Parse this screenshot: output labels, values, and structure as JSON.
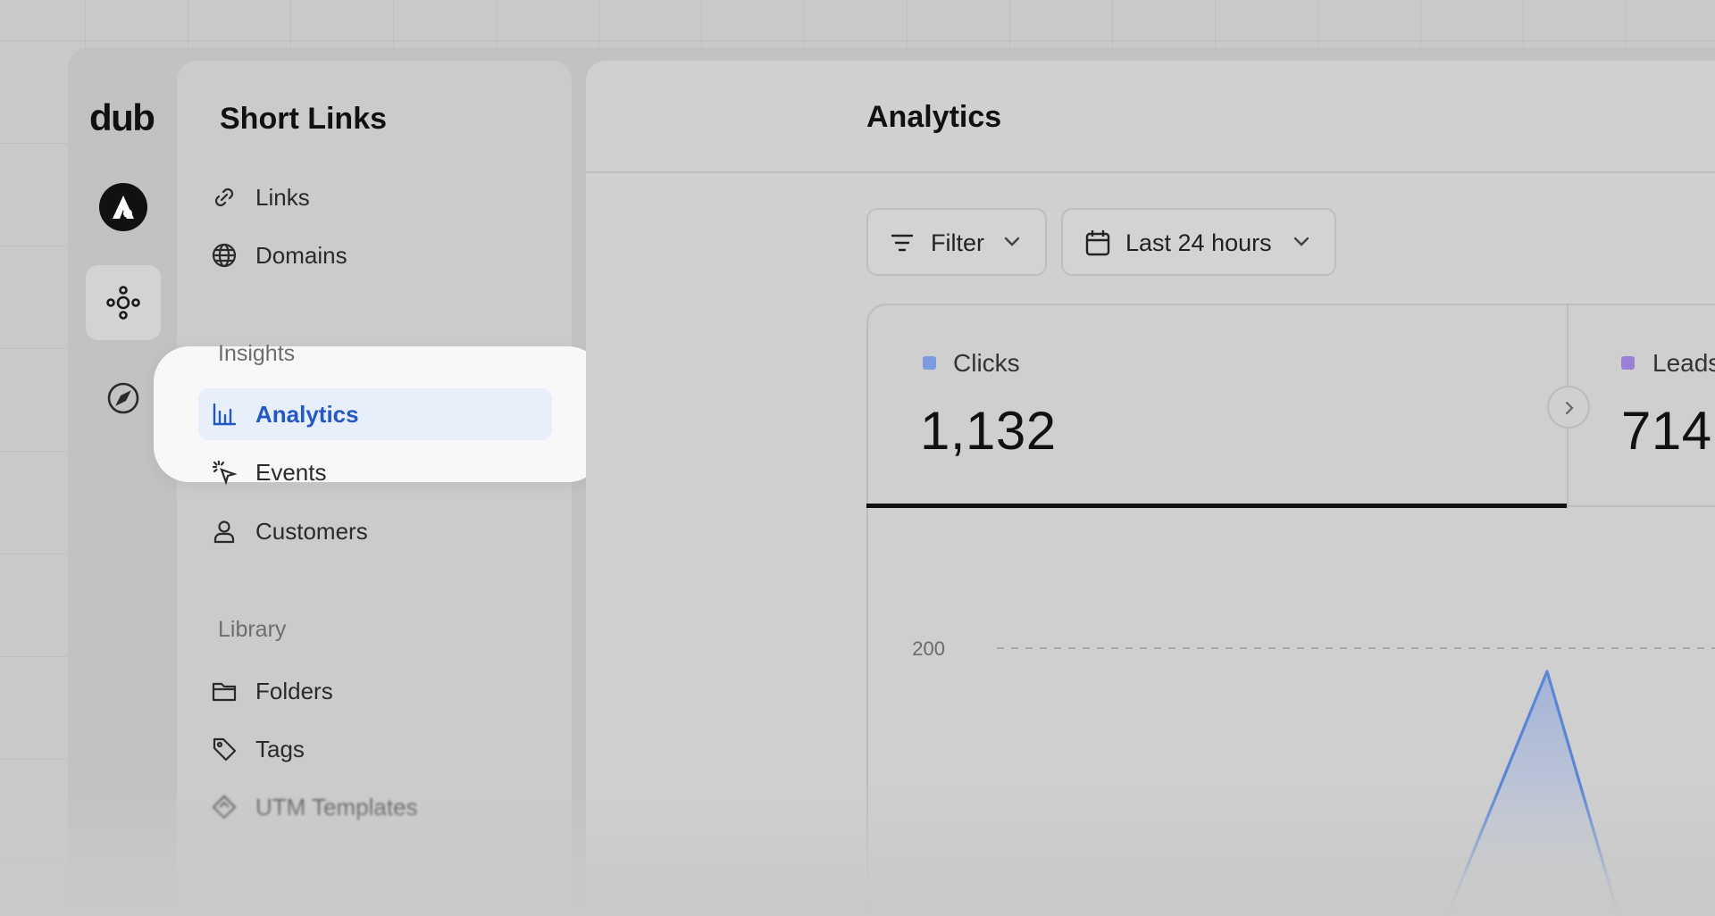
{
  "brand": {
    "logo_text": "dub"
  },
  "rail": {
    "items": [
      {
        "name": "workspace-avatar"
      },
      {
        "name": "short-links",
        "active": true
      },
      {
        "name": "explore"
      }
    ]
  },
  "sidebar": {
    "title": "Short Links",
    "items": [
      {
        "label": "Links",
        "icon": "link-icon"
      },
      {
        "label": "Domains",
        "icon": "globe-icon"
      }
    ],
    "insights": {
      "label": "Insights",
      "items": [
        {
          "label": "Analytics",
          "icon": "bar-chart-icon",
          "active": true
        },
        {
          "label": "Events",
          "icon": "cursor-rays-icon"
        },
        {
          "label": "Customers",
          "icon": "user-icon"
        }
      ]
    },
    "library": {
      "label": "Library",
      "items": [
        {
          "label": "Folders",
          "icon": "folder-icon"
        },
        {
          "label": "Tags",
          "icon": "tag-icon"
        },
        {
          "label": "UTM Templates",
          "icon": "diamond-icon"
        }
      ]
    }
  },
  "main": {
    "title": "Analytics",
    "filter_label": "Filter",
    "date_range_label": "Last 24 hours",
    "metrics": [
      {
        "label": "Clicks",
        "value": "1,132",
        "color": "#7b9be0",
        "selected": true
      },
      {
        "label": "Leads",
        "value": "714",
        "color": "#9a7fd6"
      }
    ]
  },
  "chart_data": {
    "type": "area",
    "y_tick_labels": [
      "200"
    ],
    "series": [
      {
        "name": "Clicks",
        "color": "#5b86d6"
      }
    ]
  },
  "colors": {
    "accent": "#2458c7",
    "active_bg": "#e7effb"
  }
}
